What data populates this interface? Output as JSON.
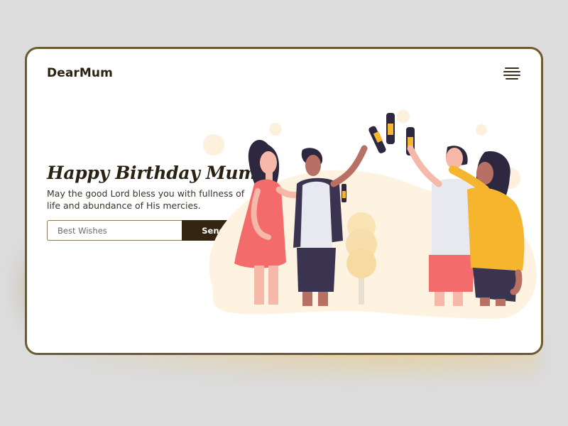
{
  "app": {
    "brand": "DearMum"
  },
  "header": {
    "menu_icon": "hamburger-menu-icon"
  },
  "hero": {
    "title": "Happy Birthday Mum",
    "subtitle": "May the good Lord bless you with fullness of life and abundance of His mercies."
  },
  "form": {
    "placeholder": "Best Wishes",
    "send_label": "Send"
  },
  "colors": {
    "frame": "#6e5a2f",
    "button": "#33250f",
    "text": "#2b2112",
    "accent_yellow": "#f5b52c",
    "accent_red": "#f36b6b",
    "blob": "#fdf3e0"
  }
}
